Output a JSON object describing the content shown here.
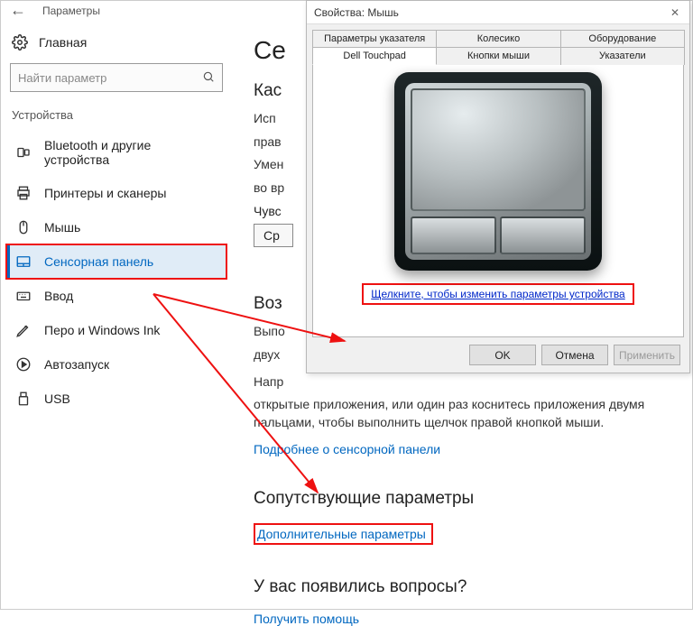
{
  "settings": {
    "title": "Параметры",
    "home": "Главная",
    "search_placeholder": "Найти параметр",
    "group": "Устройства",
    "nav": [
      {
        "label": "Bluetooth и другие устройства"
      },
      {
        "label": "Принтеры и сканеры"
      },
      {
        "label": "Мышь"
      },
      {
        "label": "Сенсорная панель"
      },
      {
        "label": "Ввод"
      },
      {
        "label": "Перо и Windows Ink"
      },
      {
        "label": "Автозапуск"
      },
      {
        "label": "USB"
      }
    ]
  },
  "main": {
    "h1": "Се",
    "h2a": "Кас",
    "p1": "Исп",
    "p2": "прав",
    "p3": "Умен",
    "p4": "во вр",
    "sens_label": "Чувс",
    "dropdown": "Ср",
    "h2b": "Воз",
    "p5": "Выпо",
    "p6": "двух",
    "p7a": "Напр",
    "p7b": "открытые приложения, или один раз коснитесь приложения двумя пальцами, чтобы выполнить щелчок правой кнопкой мыши.",
    "more_link": "Подробнее о сенсорной панели",
    "h2c": "Сопутствующие параметры",
    "adv_link": "Дополнительные параметры",
    "h2d": "У вас появились вопросы?",
    "help_link": "Получить помощь"
  },
  "dialog": {
    "title": "Свойства: Мышь",
    "tabs_row1": [
      "Параметры указателя",
      "Колесико",
      "Оборудование"
    ],
    "tabs_row2": [
      "Dell Touchpad",
      "Кнопки мыши",
      "Указатели"
    ],
    "change_link": "Щелкните, чтобы изменить параметры устройства",
    "ok": "OK",
    "cancel": "Отмена",
    "apply": "Применить"
  }
}
